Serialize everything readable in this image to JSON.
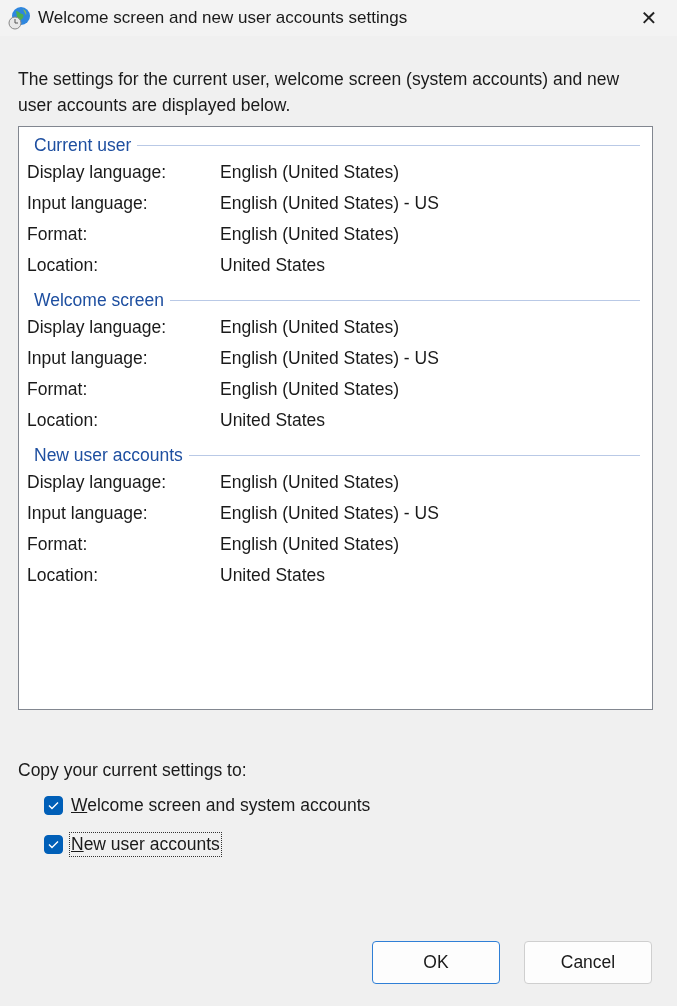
{
  "window": {
    "title": "Welcome screen and new user accounts settings",
    "close": "✕"
  },
  "intro": "The settings for the current user, welcome screen (system accounts) and new user accounts are displayed below.",
  "groups": [
    {
      "title": "Current user",
      "rows": [
        {
          "label": "Display language:",
          "value": "English (United States)"
        },
        {
          "label": "Input language:",
          "value": "English (United States) - US"
        },
        {
          "label": "Format:",
          "value": "English (United States)"
        },
        {
          "label": "Location:",
          "value": "United States"
        }
      ]
    },
    {
      "title": "Welcome screen",
      "rows": [
        {
          "label": "Display language:",
          "value": "English (United States)"
        },
        {
          "label": "Input language:",
          "value": "English (United States) - US"
        },
        {
          "label": "Format:",
          "value": "English (United States)"
        },
        {
          "label": "Location:",
          "value": "United States"
        }
      ]
    },
    {
      "title": "New user accounts",
      "rows": [
        {
          "label": "Display language:",
          "value": "English (United States)"
        },
        {
          "label": "Input language:",
          "value": "English (United States) - US"
        },
        {
          "label": "Format:",
          "value": "English (United States)"
        },
        {
          "label": "Location:",
          "value": "United States"
        }
      ]
    }
  ],
  "copy_label": "Copy your current settings to:",
  "checkboxes": [
    {
      "label": "Welcome screen and system accounts",
      "checked": true,
      "focused": false
    },
    {
      "label": "New user accounts",
      "checked": true,
      "focused": true
    }
  ],
  "buttons": [
    {
      "label": "OK",
      "default": true
    },
    {
      "label": "Cancel",
      "default": false
    }
  ]
}
